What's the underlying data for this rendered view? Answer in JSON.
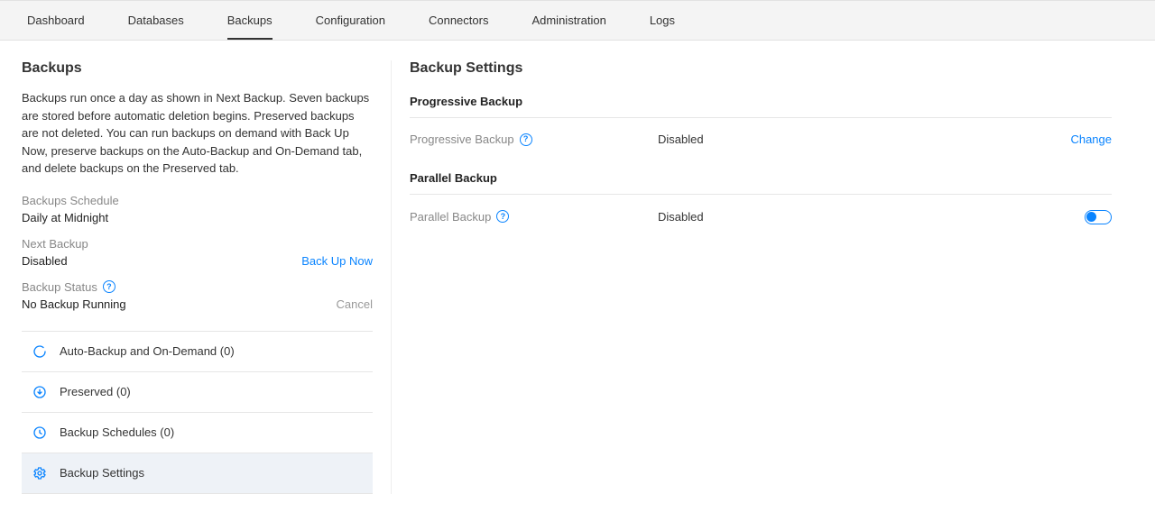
{
  "tabs": [
    {
      "label": "Dashboard"
    },
    {
      "label": "Databases"
    },
    {
      "label": "Backups"
    },
    {
      "label": "Configuration"
    },
    {
      "label": "Connectors"
    },
    {
      "label": "Administration"
    },
    {
      "label": "Logs"
    }
  ],
  "left": {
    "title": "Backups",
    "description": "Backups run once a day as shown in Next Backup. Seven backups are stored before automatic deletion begins. Preserved backups are not deleted. You can run backups on demand with Back Up Now, preserve backups on the Auto-Backup and On-Demand tab, and delete backups on the Preserved tab.",
    "schedule_label": "Backups Schedule",
    "schedule_value": "Daily at Midnight",
    "next_label": "Next Backup",
    "next_value": "Disabled",
    "backup_now": "Back Up Now",
    "status_label": "Backup Status",
    "status_value": "No Backup Running",
    "cancel": "Cancel",
    "nav": {
      "item0": "Auto-Backup and On-Demand (0)",
      "item1": "Preserved (0)",
      "item2": "Backup Schedules (0)",
      "item3": "Backup Settings"
    }
  },
  "right": {
    "title": "Backup Settings",
    "progressive_header": "Progressive Backup",
    "progressive_label": "Progressive Backup",
    "progressive_value": "Disabled",
    "progressive_action": "Change",
    "parallel_header": "Parallel Backup",
    "parallel_label": "Parallel Backup",
    "parallel_value": "Disabled"
  }
}
